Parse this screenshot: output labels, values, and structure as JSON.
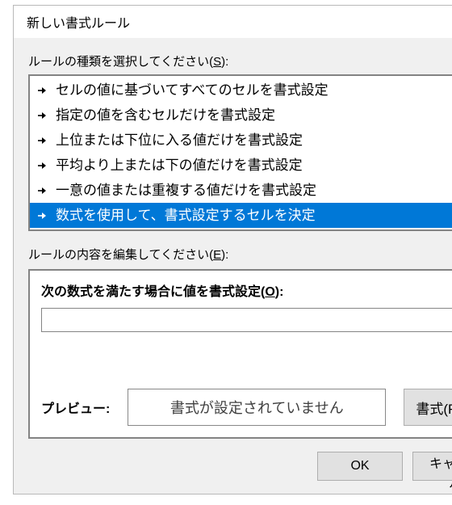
{
  "dialog": {
    "title": "新しい書式ルール"
  },
  "select_rule": {
    "label_prefix": "ルールの種類を選択してください(",
    "label_underline": "S",
    "label_suffix": "):"
  },
  "rule_types": [
    {
      "text": "セルの値に基づいてすべてのセルを書式設定",
      "selected": false
    },
    {
      "text": "指定の値を含むセルだけを書式設定",
      "selected": false
    },
    {
      "text": "上位または下位に入る値だけを書式設定",
      "selected": false
    },
    {
      "text": "平均より上または下の値だけを書式設定",
      "selected": false
    },
    {
      "text": "一意の値または重複する値だけを書式設定",
      "selected": false
    },
    {
      "text": "数式を使用して、書式設定するセルを決定",
      "selected": true
    }
  ],
  "edit_rule": {
    "label_prefix": "ルールの内容を編集してください(",
    "label_underline": "E",
    "label_suffix": "):"
  },
  "formula": {
    "label_prefix": "次の数式を満たす場合に値を書式設定(",
    "label_underline": "O",
    "label_suffix": "):",
    "value": ""
  },
  "preview": {
    "label": "プレビュー:",
    "text": "書式が設定されていません"
  },
  "buttons": {
    "format": "書式(F)...",
    "ok": "OK",
    "cancel": "キャンセル"
  },
  "colors": {
    "selection": "#0078d7"
  }
}
